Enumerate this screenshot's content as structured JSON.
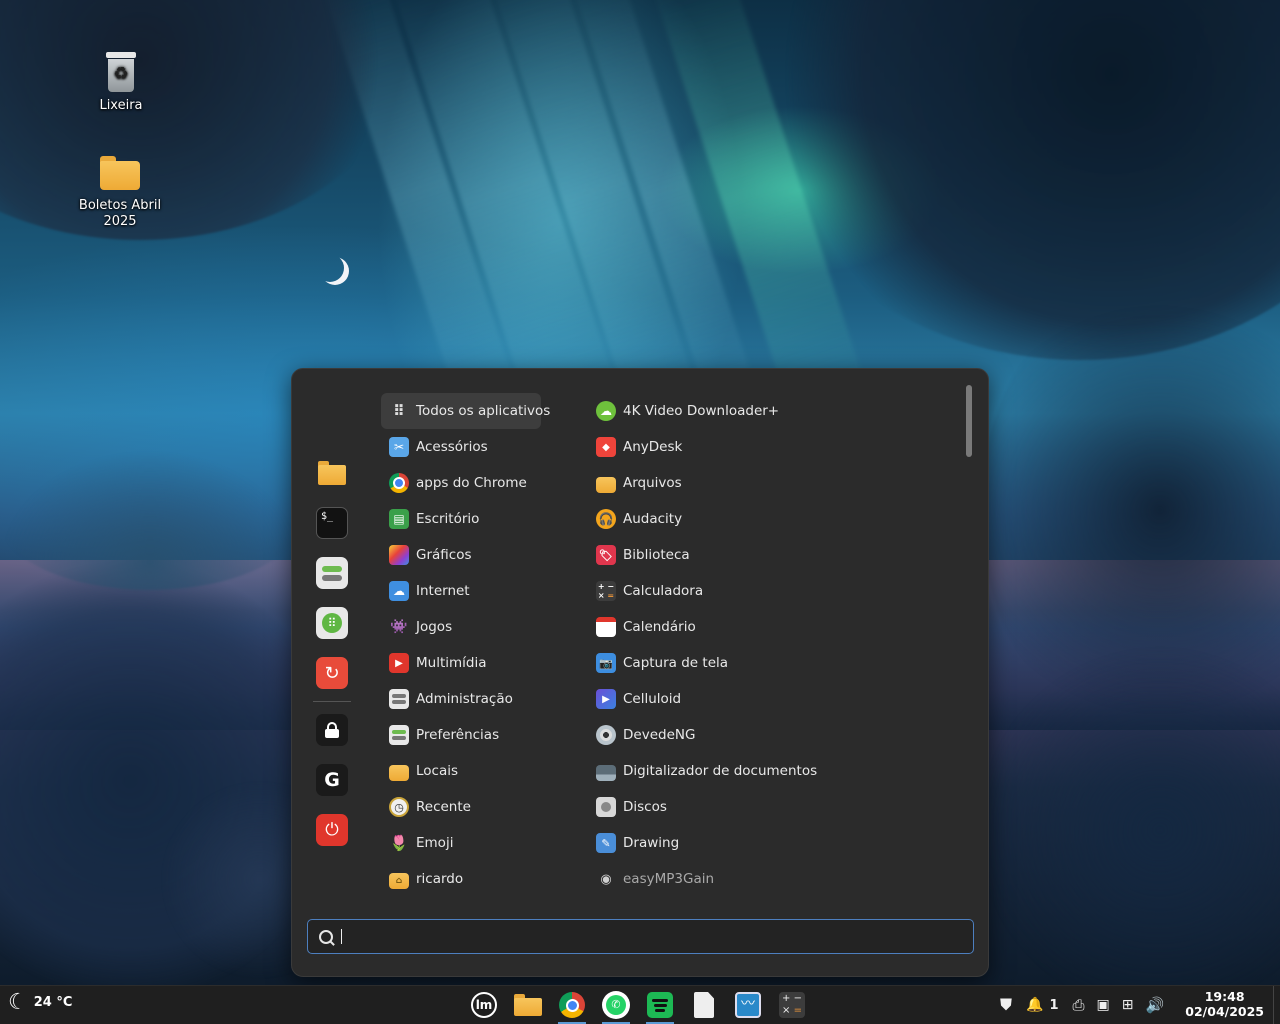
{
  "desktop": {
    "icons": [
      {
        "label": "Lixeira"
      },
      {
        "label": "Boletos Abril 2025"
      }
    ]
  },
  "menu": {
    "favorites": [
      {
        "name": "folder-icon"
      },
      {
        "name": "terminal-icon"
      },
      {
        "name": "settings-toggle-icon"
      },
      {
        "name": "software-manager-icon"
      },
      {
        "name": "backup-icon"
      },
      {
        "name": "lock-icon"
      },
      {
        "name": "logout-icon"
      },
      {
        "name": "power-icon"
      }
    ],
    "categories": [
      {
        "label": "Todos os aplicativos",
        "selected": true
      },
      {
        "label": "Acessórios"
      },
      {
        "label": "apps do Chrome"
      },
      {
        "label": "Escritório"
      },
      {
        "label": "Gráficos"
      },
      {
        "label": "Internet"
      },
      {
        "label": "Jogos"
      },
      {
        "label": "Multimídia"
      },
      {
        "label": "Administração"
      },
      {
        "label": "Preferências"
      },
      {
        "label": "Locais"
      },
      {
        "label": "Recente"
      },
      {
        "label": "Emoji"
      },
      {
        "label": "ricardo"
      }
    ],
    "apps": [
      {
        "label": "4K Video Downloader+"
      },
      {
        "label": "AnyDesk"
      },
      {
        "label": "Arquivos"
      },
      {
        "label": "Audacity"
      },
      {
        "label": "Biblioteca"
      },
      {
        "label": "Calculadora"
      },
      {
        "label": "Calendário"
      },
      {
        "label": "Captura de tela"
      },
      {
        "label": "Celluloid"
      },
      {
        "label": "DevedeNG"
      },
      {
        "label": "Digitalizador de documentos"
      },
      {
        "label": "Discos"
      },
      {
        "label": "Drawing"
      },
      {
        "label": "easyMP3Gain"
      }
    ],
    "search": {
      "value": "",
      "placeholder": ""
    }
  },
  "taskbar": {
    "weather": "24 °C",
    "notifications_count": "1",
    "clock_time": "19:48",
    "clock_date": "02/04/2025",
    "colors": {
      "accent": "#5b9bd5"
    }
  }
}
